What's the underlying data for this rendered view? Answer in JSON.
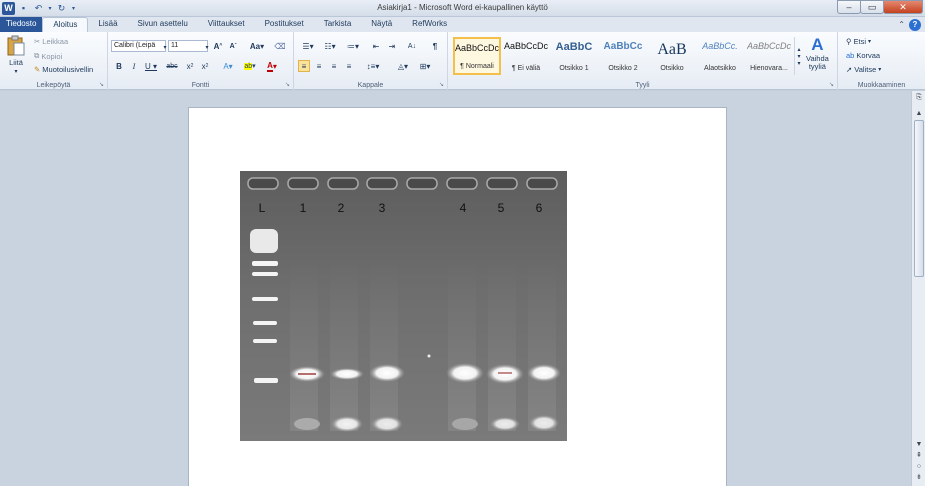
{
  "window": {
    "title": "Asiakirja1 - Microsoft Word ei-kaupallinen käyttö",
    "app_logo": "W",
    "controls": [
      "minimize-icon",
      "maximize-icon",
      "close-icon"
    ]
  },
  "tabs": [
    {
      "label": "Tiedosto",
      "kind": "file"
    },
    {
      "label": "Aloitus",
      "kind": "active"
    },
    {
      "label": "Lisää"
    },
    {
      "label": "Sivun asettelu"
    },
    {
      "label": "Viittaukset"
    },
    {
      "label": "Postitukset"
    },
    {
      "label": "Tarkista"
    },
    {
      "label": "Näytä"
    },
    {
      "label": "RefWorks"
    }
  ],
  "ribbon": {
    "clipboard": {
      "label": "Leikepöytä",
      "paste": "Liitä",
      "cut": "Leikkaa",
      "copy": "Kopioi",
      "format_painter": "Muotoilusivellin"
    },
    "font": {
      "label": "Fontti",
      "font_name": "Calibri (Leipä",
      "font_size": "11"
    },
    "paragraph": {
      "label": "Kappale"
    },
    "styles": {
      "label": "Tyyli",
      "items": [
        {
          "sample": "AaBbCcDc",
          "name": "¶ Normaali"
        },
        {
          "sample": "AaBbCcDc",
          "name": "¶ Ei väliä"
        },
        {
          "sample": "AaBbC",
          "name": "Otsikko 1"
        },
        {
          "sample": "AaBbCc",
          "name": "Otsikko 2"
        },
        {
          "sample": "AaB",
          "name": "Otsikko"
        },
        {
          "sample": "AaBbCc.",
          "name": "Alaotsikko"
        },
        {
          "sample": "AaBbCcDc",
          "name": "Hienovara..."
        }
      ],
      "change_styles_line1": "Vaihda",
      "change_styles_line2": "tyyliä"
    },
    "editing": {
      "label": "Muokkaaminen",
      "find": "Etsi",
      "replace": "Korvaa",
      "select": "Valitse"
    }
  },
  "document": {
    "gel_lane_labels": [
      "L",
      "1",
      "2",
      "3",
      "4",
      "5",
      "6"
    ]
  },
  "colors": {
    "file_tab": "#2b579a",
    "highlight_selected_style": "#f4c04b",
    "gel_background": "#6e6e6e"
  }
}
